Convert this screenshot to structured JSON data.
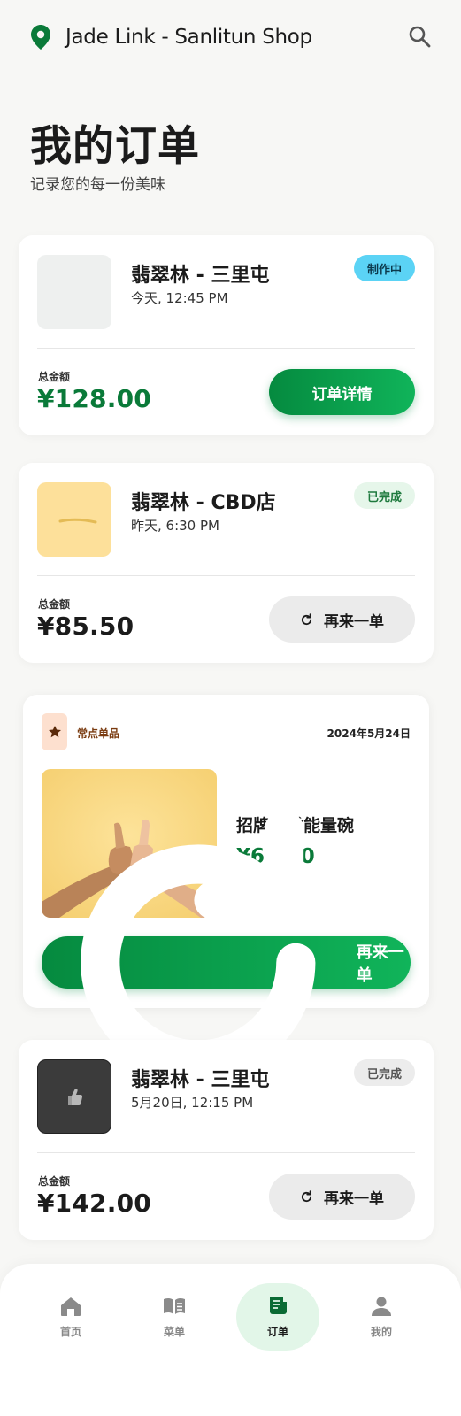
{
  "header": {
    "shop_name": "Jade Link - Sanlitun Shop"
  },
  "page": {
    "title": "我的订单",
    "subtitle": "记录您的每一份美味"
  },
  "total_label": "总金额",
  "orders": [
    {
      "store": "翡翠林 - 三里屯",
      "time": "今天, 12:45 PM",
      "status": "制作中",
      "total": "¥128.00",
      "action": "订单详情"
    },
    {
      "store": "翡翠林 - CBD店",
      "time": "昨天, 6:30 PM",
      "status": "已完成",
      "total": "¥85.50",
      "action": "再来一单"
    },
    {
      "store": "翡翠林 - 三里屯",
      "time": "5月20日, 12:15 PM",
      "status": "已完成",
      "total": "¥142.00",
      "action": "再来一单"
    }
  ],
  "favorite": {
    "tag": "常点单品",
    "date": "2024年5月24日",
    "item_name": "招牌春季能量碗",
    "price": "¥62.00",
    "action": "再来一单"
  },
  "nav": [
    {
      "label": "首页",
      "icon": "home-icon"
    },
    {
      "label": "菜单",
      "icon": "menu-book-icon"
    },
    {
      "label": "订单",
      "icon": "receipt-icon",
      "active": true
    },
    {
      "label": "我的",
      "icon": "person-icon"
    }
  ],
  "colors": {
    "brand_green": "#0a7a39",
    "status_active": "#5bd3f5",
    "status_done_green": "#e6f6ea",
    "status_done_gray": "#ececec"
  }
}
